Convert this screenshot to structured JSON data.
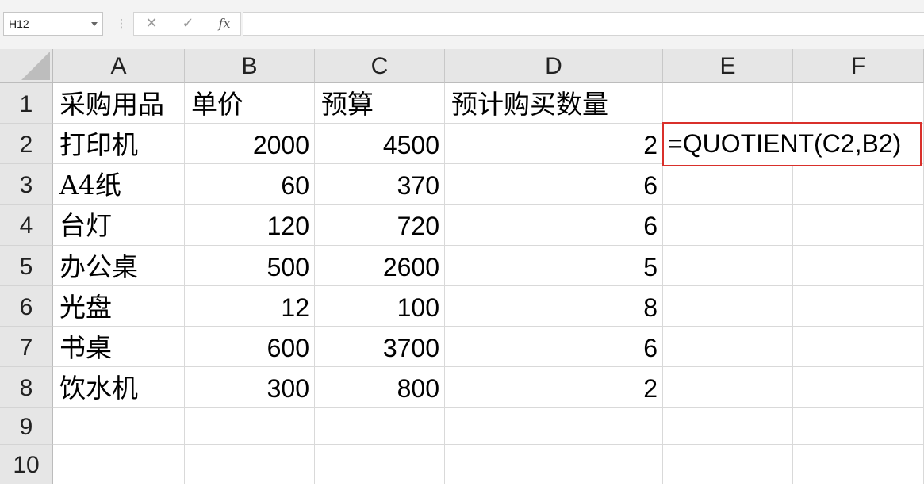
{
  "name_box": {
    "value": "H12"
  },
  "formula_bar": {
    "cancel_icon": "cancel-icon",
    "enter_icon": "check-icon",
    "fx_label": "fx",
    "value": ""
  },
  "columns": [
    "A",
    "B",
    "C",
    "D",
    "E",
    "F"
  ],
  "rows": [
    "1",
    "2",
    "3",
    "4",
    "5",
    "6",
    "7",
    "8",
    "9",
    "10"
  ],
  "headers": {
    "a": "采购用品",
    "b": "单价",
    "c": "预算",
    "d": "预计购买数量"
  },
  "table": [
    {
      "item": "打印机",
      "price": "2000",
      "budget": "4500",
      "qty": "2"
    },
    {
      "item": "A4纸",
      "price": "60",
      "budget": "370",
      "qty": "6"
    },
    {
      "item": "台灯",
      "price": "120",
      "budget": "720",
      "qty": "6"
    },
    {
      "item": "办公桌",
      "price": "500",
      "budget": "2600",
      "qty": "5"
    },
    {
      "item": "光盘",
      "price": "12",
      "budget": "100",
      "qty": "8"
    },
    {
      "item": "书桌",
      "price": "600",
      "budget": "3700",
      "qty": "6"
    },
    {
      "item": "饮水机",
      "price": "300",
      "budget": "800",
      "qty": "2"
    }
  ],
  "formula_cell": {
    "text": "=QUOTIENT(C2,B2)",
    "highlight_color": "#d9302b"
  }
}
